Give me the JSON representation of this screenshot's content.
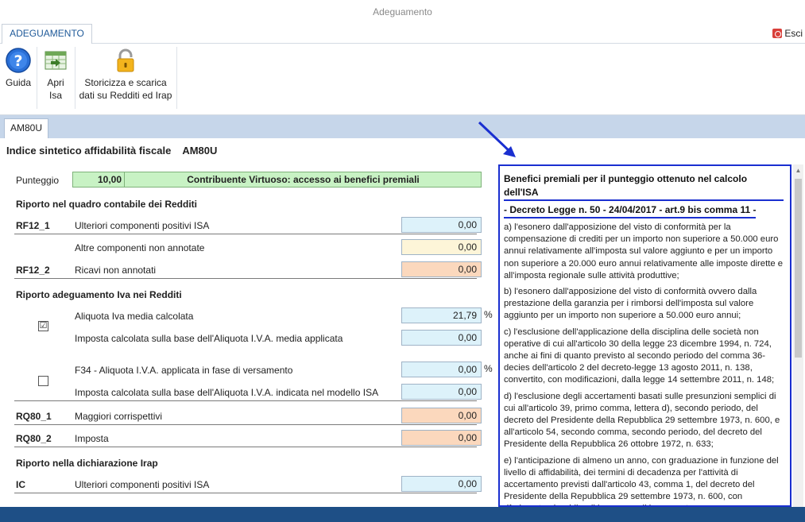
{
  "window": {
    "title": "Adeguamento"
  },
  "ribbon": {
    "tab": "ADEGUAMENTO",
    "exit": "Esci",
    "buttons": {
      "guide": "Guida",
      "open_isa_1": "Apri",
      "open_isa_2": "Isa",
      "store_1": "Storicizza e scarica",
      "store_2": "dati su Redditi ed Irap"
    }
  },
  "doc_tab": "AM80U",
  "page": {
    "title": "Indice sintetico affidabilità fiscale",
    "code": "AM80U"
  },
  "score": {
    "label": "Punteggio",
    "value": "10,00",
    "text": "Contribuente Virtuoso: accesso ai benefici premiali"
  },
  "sections": {
    "redditi": "Riporto nel quadro contabile dei Redditi",
    "iva": "Riporto adeguamento Iva nei Redditi",
    "irap": "Riporto nella dichiarazione Irap"
  },
  "rows": {
    "rf12_1": {
      "code": "RF12_1",
      "desc": "Ulteriori componenti positivi ISA",
      "value": "0,00"
    },
    "altre": {
      "desc": "Altre componenti non annotate",
      "value": "0,00"
    },
    "rf12_2": {
      "code": "RF12_2",
      "desc": "Ricavi non annotati",
      "value": "0,00"
    },
    "aliquota": {
      "desc": "Aliquota Iva media calcolata",
      "value": "21,79",
      "unit": "%"
    },
    "imposta_media": {
      "desc": "Imposta calcolata sulla base dell'Aliquota I.V.A. media applicata",
      "value": "0,00"
    },
    "f34": {
      "desc": "F34 - Aliquota I.V.A. applicata in fase di versamento",
      "value": "0,00",
      "unit": "%"
    },
    "imposta_isa": {
      "desc": "Imposta calcolata sulla base dell'Aliquota I.V.A. indicata nel modello ISA",
      "value": "0,00"
    },
    "rq80_1": {
      "code": "RQ80_1",
      "desc": "Maggiori corrispettivi",
      "value": "0,00"
    },
    "rq80_2": {
      "code": "RQ80_2",
      "desc": "Imposta",
      "value": "0,00"
    },
    "ic": {
      "code": "IC",
      "desc": "Ulteriori componenti positivi ISA",
      "value": "0,00"
    }
  },
  "checkboxes": {
    "checked_mark": "☑",
    "unchecked_mark": ""
  },
  "info": {
    "title_1": "Benefici premiali per il punteggio ottenuto nel calcolo dell'ISA",
    "title_2": "- Decreto Legge n. 50 - 24/04/2017 - art.9 bis comma 11 -",
    "a": "a) l'esonero dall'apposizione del visto di conformità per la compensazione di crediti per un importo non superiore a 50.000 euro annui relativamente all'imposta sul valore aggiunto e per un importo non superiore a 20.000 euro annui relativamente alle imposte dirette e all'imposta regionale sulle attività produttive;",
    "b": "b) l'esonero dall'apposizione del visto di conformità ovvero dalla prestazione della garanzia per i rimborsi dell'imposta sul valore aggiunto per un importo non superiore a 50.000 euro annui;",
    "c": "c) l'esclusione dell'applicazione della disciplina delle società non operative di cui all'articolo 30 della legge 23 dicembre 1994, n. 724, anche ai fini di quanto previsto al secondo periodo del comma 36-decies dell'articolo 2 del decreto-legge 13 agosto 2011, n. 138, convertito, con modificazioni, dalla legge 14 settembre 2011, n. 148;",
    "d": "d) l'esclusione degli accertamenti basati sulle presunzioni semplici di cui all'articolo 39, primo comma, lettera d), secondo periodo, del decreto del Presidente della Repubblica 29 settembre 1973, n. 600, e all'articolo 54, secondo comma, secondo periodo, del decreto del Presidente della Repubblica 26 ottobre 1972, n. 633;",
    "e": "e) l'anticipazione di almeno un anno, con graduazione in funzione del livello di affidabilità, dei termini di decadenza per l'attività di accertamento previsti dall'articolo 43, comma 1, del decreto del Presidente della Repubblica 29 settembre 1973, n. 600, con riferimento al reddito di impresa e di lavoro autonomo, e"
  },
  "colors": {
    "accent": "#1a2fd0",
    "band": "#c6d6ea",
    "bottom": "#1e4f86",
    "score": "#c8f2c4"
  }
}
